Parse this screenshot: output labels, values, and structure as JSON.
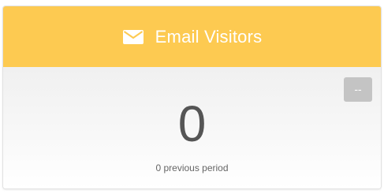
{
  "widget": {
    "title": "Email Visitors",
    "icon": "envelope-icon",
    "header_color": "#fdca51",
    "collapse_label": "--",
    "value": "0",
    "previous_period_text": "0 previous period"
  }
}
